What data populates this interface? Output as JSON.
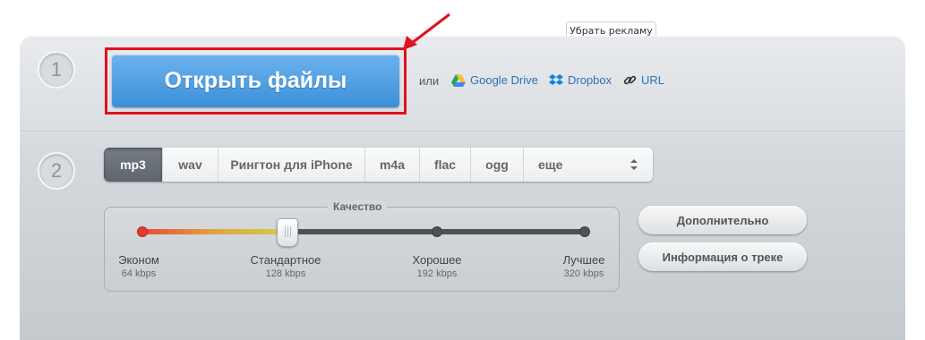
{
  "ad": {
    "remove_label": "Убрать рекламу"
  },
  "steps": [
    "1",
    "2"
  ],
  "open": {
    "label": "Открыть файлы"
  },
  "sources": {
    "or_label": "или",
    "google_drive": "Google Drive",
    "dropbox": "Dropbox",
    "url": "URL"
  },
  "formats": {
    "selected": "mp3",
    "items": [
      "mp3",
      "wav",
      "Рингтон для iPhone",
      "m4a",
      "flac",
      "ogg",
      "еще"
    ]
  },
  "quality": {
    "label": "Качество",
    "selected_index": 1,
    "levels": [
      {
        "name": "Эконом",
        "kbps": "64 kbps"
      },
      {
        "name": "Стандартное",
        "kbps": "128 kbps"
      },
      {
        "name": "Хорошее",
        "kbps": "192 kbps"
      },
      {
        "name": "Лучшее",
        "kbps": "320 kbps"
      }
    ]
  },
  "buttons": {
    "advanced": "Дополнительно",
    "track_info": "Информация о треке"
  },
  "colors": {
    "primary_button": "#4a9be0",
    "highlight_border": "#e0121f",
    "link": "#2f6fb7",
    "active_format": "#6a7078"
  }
}
